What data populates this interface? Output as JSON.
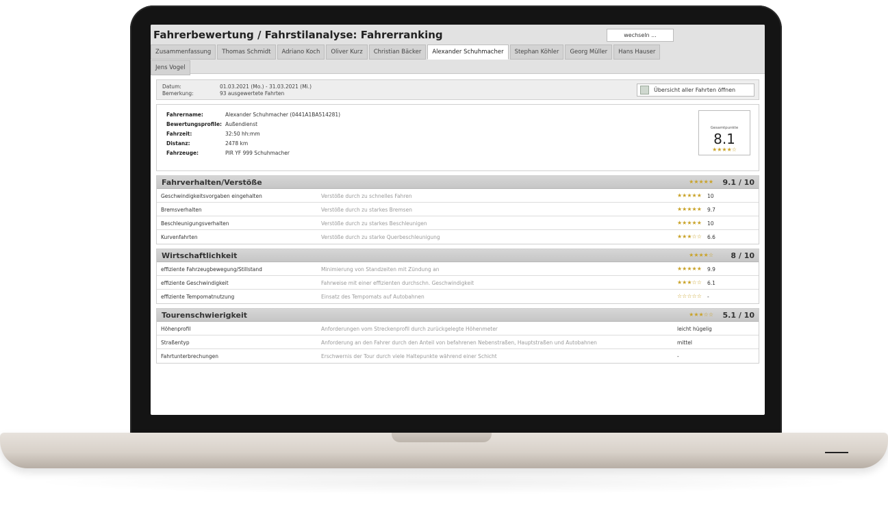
{
  "header": {
    "title": "Fahrerbewertung / Fahrstilanalyse: Fahrerranking",
    "switch_label": "wechseln ..."
  },
  "tabs": [
    {
      "label": "Zusammenfassung"
    },
    {
      "label": "Thomas Schmidt"
    },
    {
      "label": "Adriano Koch"
    },
    {
      "label": "Oliver Kurz"
    },
    {
      "label": "Christian Bäcker"
    },
    {
      "label": "Alexander Schuhmacher",
      "active": true
    },
    {
      "label": "Stephan Köhler"
    },
    {
      "label": "Georg Müller"
    },
    {
      "label": "Hans Hauser"
    },
    {
      "label": "Jens Vogel"
    }
  ],
  "info": {
    "date_label": "Datum:",
    "date_value": "01.03.2021 (Mo.) - 31.03.2021 (Mi.)",
    "note_label": "Bemerkung:",
    "note_value": "93 ausgewertete Fahrten",
    "open_button": "Übersicht aller Fahrten öffnen"
  },
  "driver": {
    "name_label": "Fahrername:",
    "name_value": "Alexander Schuhmacher (0441A1BA514281)",
    "profile_label": "Bewertungsprofile:",
    "profile_value": "Außendienst",
    "time_label": "Fahrzeit:",
    "time_value": "32:50 hh:mm",
    "distance_label": "Distanz:",
    "distance_value": "2478 km",
    "vehicle_label": "Fahrzeuge:",
    "vehicle_value": "PIR YF 999 Schuhmacher",
    "total_label": "Gesamtpunkte",
    "total_value": "8.1",
    "total_stars": "★★★★☆"
  },
  "sections": {
    "s1": {
      "title": "Fahrverhalten/Verstöße",
      "stars": "★★★★★",
      "score": "9.1 / 10",
      "rows": [
        {
          "name": "Geschwindigkeitsvorgaben eingehalten",
          "desc": "Verstöße durch zu schnelles Fahren",
          "stars": "★★★★★",
          "value": "10"
        },
        {
          "name": "Bremsverhalten",
          "desc": "Verstöße durch zu starkes Bremsen",
          "stars": "★★★★★",
          "value": "9.7"
        },
        {
          "name": "Beschleunigungsverhalten",
          "desc": "Verstöße durch zu starkes Beschleunigen",
          "stars": "★★★★★",
          "value": "10"
        },
        {
          "name": "Kurvenfahrten",
          "desc": "Verstöße durch zu starke Querbeschleunigung",
          "stars": "★★★☆☆",
          "value": "6.6"
        }
      ]
    },
    "s2": {
      "title": "Wirtschaftlichkeit",
      "stars": "★★★★☆",
      "score": "8 / 10",
      "rows": [
        {
          "name": "effiziente Fahrzeugbewegung/Stillstand",
          "desc": "Minimierung von Standzeiten mit Zündung an",
          "stars": "★★★★★",
          "value": "9.9"
        },
        {
          "name": "effiziente Geschwindigkeit",
          "desc": "Fahrweise mit einer effizienten durchschn. Geschwindigkeit",
          "stars": "★★★☆☆",
          "value": "6.1"
        },
        {
          "name": "effiziente Tempomatnutzung",
          "desc": "Einsatz des Tempomats auf Autobahnen",
          "stars": "☆☆☆☆☆",
          "value": "-"
        }
      ]
    },
    "s3": {
      "title": "Tourenschwierigkeit",
      "stars": "★★★☆☆",
      "score": "5.1 / 10",
      "rows": [
        {
          "name": "Höhenprofil",
          "desc": "Anforderungen vom Streckenprofil durch zurückgelegte Höhenmeter",
          "value": "leicht hügelig"
        },
        {
          "name": "Straßentyp",
          "desc": "Anforderung an den Fahrer durch den Anteil von befahrenen Nebenstraßen, Hauptstraßen und Autobahnen",
          "value": "mittel"
        },
        {
          "name": "Fahrtunterbrechungen",
          "desc": "Erschwernis der Tour durch viele Haltepunkte während einer Schicht",
          "value": "-"
        }
      ]
    }
  }
}
